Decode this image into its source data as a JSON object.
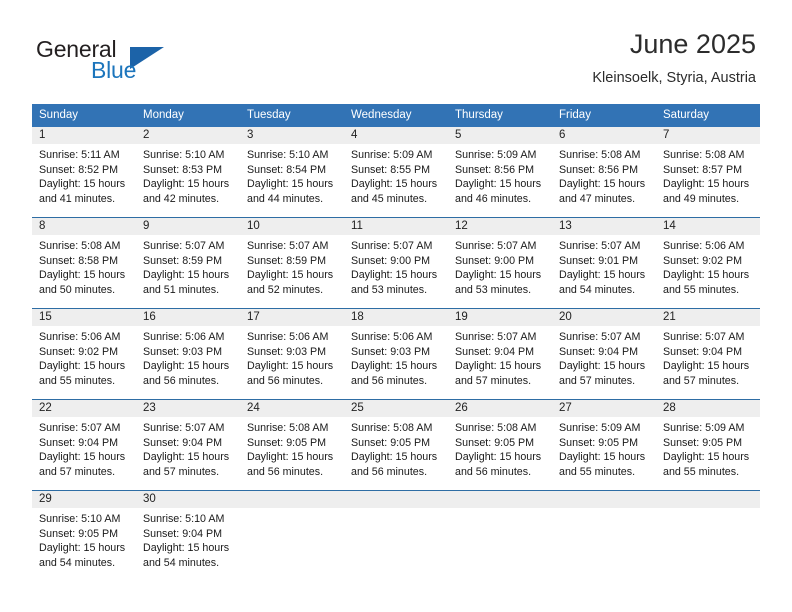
{
  "brand": {
    "name_top": "General",
    "name_bottom": "Blue",
    "accent_color": "#1c75bc",
    "triangle_color": "#1c63a8"
  },
  "header": {
    "title": "June 2025",
    "location": "Kleinsoelk, Styria, Austria"
  },
  "theme": {
    "header_bg": "#3273b5",
    "row_divider": "#2e6da4",
    "daynum_band_bg": "#eeeeee"
  },
  "weekday_headers": [
    "Sunday",
    "Monday",
    "Tuesday",
    "Wednesday",
    "Thursday",
    "Friday",
    "Saturday"
  ],
  "weeks": [
    {
      "days": [
        {
          "num": "1",
          "sunrise": "Sunrise: 5:11 AM",
          "sunset": "Sunset: 8:52 PM",
          "daylight_1": "Daylight: 15 hours",
          "daylight_2": "and 41 minutes."
        },
        {
          "num": "2",
          "sunrise": "Sunrise: 5:10 AM",
          "sunset": "Sunset: 8:53 PM",
          "daylight_1": "Daylight: 15 hours",
          "daylight_2": "and 42 minutes."
        },
        {
          "num": "3",
          "sunrise": "Sunrise: 5:10 AM",
          "sunset": "Sunset: 8:54 PM",
          "daylight_1": "Daylight: 15 hours",
          "daylight_2": "and 44 minutes."
        },
        {
          "num": "4",
          "sunrise": "Sunrise: 5:09 AM",
          "sunset": "Sunset: 8:55 PM",
          "daylight_1": "Daylight: 15 hours",
          "daylight_2": "and 45 minutes."
        },
        {
          "num": "5",
          "sunrise": "Sunrise: 5:09 AM",
          "sunset": "Sunset: 8:56 PM",
          "daylight_1": "Daylight: 15 hours",
          "daylight_2": "and 46 minutes."
        },
        {
          "num": "6",
          "sunrise": "Sunrise: 5:08 AM",
          "sunset": "Sunset: 8:56 PM",
          "daylight_1": "Daylight: 15 hours",
          "daylight_2": "and 47 minutes."
        },
        {
          "num": "7",
          "sunrise": "Sunrise: 5:08 AM",
          "sunset": "Sunset: 8:57 PM",
          "daylight_1": "Daylight: 15 hours",
          "daylight_2": "and 49 minutes."
        }
      ]
    },
    {
      "days": [
        {
          "num": "8",
          "sunrise": "Sunrise: 5:08 AM",
          "sunset": "Sunset: 8:58 PM",
          "daylight_1": "Daylight: 15 hours",
          "daylight_2": "and 50 minutes."
        },
        {
          "num": "9",
          "sunrise": "Sunrise: 5:07 AM",
          "sunset": "Sunset: 8:59 PM",
          "daylight_1": "Daylight: 15 hours",
          "daylight_2": "and 51 minutes."
        },
        {
          "num": "10",
          "sunrise": "Sunrise: 5:07 AM",
          "sunset": "Sunset: 8:59 PM",
          "daylight_1": "Daylight: 15 hours",
          "daylight_2": "and 52 minutes."
        },
        {
          "num": "11",
          "sunrise": "Sunrise: 5:07 AM",
          "sunset": "Sunset: 9:00 PM",
          "daylight_1": "Daylight: 15 hours",
          "daylight_2": "and 53 minutes."
        },
        {
          "num": "12",
          "sunrise": "Sunrise: 5:07 AM",
          "sunset": "Sunset: 9:00 PM",
          "daylight_1": "Daylight: 15 hours",
          "daylight_2": "and 53 minutes."
        },
        {
          "num": "13",
          "sunrise": "Sunrise: 5:07 AM",
          "sunset": "Sunset: 9:01 PM",
          "daylight_1": "Daylight: 15 hours",
          "daylight_2": "and 54 minutes."
        },
        {
          "num": "14",
          "sunrise": "Sunrise: 5:06 AM",
          "sunset": "Sunset: 9:02 PM",
          "daylight_1": "Daylight: 15 hours",
          "daylight_2": "and 55 minutes."
        }
      ]
    },
    {
      "days": [
        {
          "num": "15",
          "sunrise": "Sunrise: 5:06 AM",
          "sunset": "Sunset: 9:02 PM",
          "daylight_1": "Daylight: 15 hours",
          "daylight_2": "and 55 minutes."
        },
        {
          "num": "16",
          "sunrise": "Sunrise: 5:06 AM",
          "sunset": "Sunset: 9:03 PM",
          "daylight_1": "Daylight: 15 hours",
          "daylight_2": "and 56 minutes."
        },
        {
          "num": "17",
          "sunrise": "Sunrise: 5:06 AM",
          "sunset": "Sunset: 9:03 PM",
          "daylight_1": "Daylight: 15 hours",
          "daylight_2": "and 56 minutes."
        },
        {
          "num": "18",
          "sunrise": "Sunrise: 5:06 AM",
          "sunset": "Sunset: 9:03 PM",
          "daylight_1": "Daylight: 15 hours",
          "daylight_2": "and 56 minutes."
        },
        {
          "num": "19",
          "sunrise": "Sunrise: 5:07 AM",
          "sunset": "Sunset: 9:04 PM",
          "daylight_1": "Daylight: 15 hours",
          "daylight_2": "and 57 minutes."
        },
        {
          "num": "20",
          "sunrise": "Sunrise: 5:07 AM",
          "sunset": "Sunset: 9:04 PM",
          "daylight_1": "Daylight: 15 hours",
          "daylight_2": "and 57 minutes."
        },
        {
          "num": "21",
          "sunrise": "Sunrise: 5:07 AM",
          "sunset": "Sunset: 9:04 PM",
          "daylight_1": "Daylight: 15 hours",
          "daylight_2": "and 57 minutes."
        }
      ]
    },
    {
      "days": [
        {
          "num": "22",
          "sunrise": "Sunrise: 5:07 AM",
          "sunset": "Sunset: 9:04 PM",
          "daylight_1": "Daylight: 15 hours",
          "daylight_2": "and 57 minutes."
        },
        {
          "num": "23",
          "sunrise": "Sunrise: 5:07 AM",
          "sunset": "Sunset: 9:04 PM",
          "daylight_1": "Daylight: 15 hours",
          "daylight_2": "and 57 minutes."
        },
        {
          "num": "24",
          "sunrise": "Sunrise: 5:08 AM",
          "sunset": "Sunset: 9:05 PM",
          "daylight_1": "Daylight: 15 hours",
          "daylight_2": "and 56 minutes."
        },
        {
          "num": "25",
          "sunrise": "Sunrise: 5:08 AM",
          "sunset": "Sunset: 9:05 PM",
          "daylight_1": "Daylight: 15 hours",
          "daylight_2": "and 56 minutes."
        },
        {
          "num": "26",
          "sunrise": "Sunrise: 5:08 AM",
          "sunset": "Sunset: 9:05 PM",
          "daylight_1": "Daylight: 15 hours",
          "daylight_2": "and 56 minutes."
        },
        {
          "num": "27",
          "sunrise": "Sunrise: 5:09 AM",
          "sunset": "Sunset: 9:05 PM",
          "daylight_1": "Daylight: 15 hours",
          "daylight_2": "and 55 minutes."
        },
        {
          "num": "28",
          "sunrise": "Sunrise: 5:09 AM",
          "sunset": "Sunset: 9:05 PM",
          "daylight_1": "Daylight: 15 hours",
          "daylight_2": "and 55 minutes."
        }
      ]
    },
    {
      "days": [
        {
          "num": "29",
          "sunrise": "Sunrise: 5:10 AM",
          "sunset": "Sunset: 9:05 PM",
          "daylight_1": "Daylight: 15 hours",
          "daylight_2": "and 54 minutes."
        },
        {
          "num": "30",
          "sunrise": "Sunrise: 5:10 AM",
          "sunset": "Sunset: 9:04 PM",
          "daylight_1": "Daylight: 15 hours",
          "daylight_2": "and 54 minutes."
        },
        {
          "num": "",
          "sunrise": "",
          "sunset": "",
          "daylight_1": "",
          "daylight_2": ""
        },
        {
          "num": "",
          "sunrise": "",
          "sunset": "",
          "daylight_1": "",
          "daylight_2": ""
        },
        {
          "num": "",
          "sunrise": "",
          "sunset": "",
          "daylight_1": "",
          "daylight_2": ""
        },
        {
          "num": "",
          "sunrise": "",
          "sunset": "",
          "daylight_1": "",
          "daylight_2": ""
        },
        {
          "num": "",
          "sunrise": "",
          "sunset": "",
          "daylight_1": "",
          "daylight_2": ""
        }
      ]
    }
  ]
}
